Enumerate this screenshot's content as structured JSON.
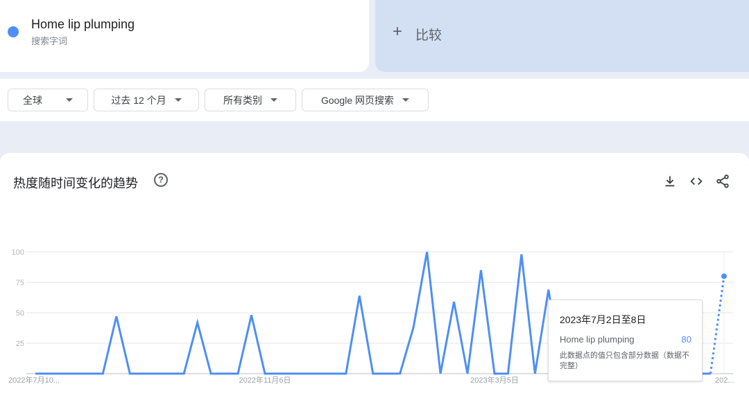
{
  "term": {
    "name": "Home lip plumping",
    "subtitle": "搜索字词",
    "color": "#4e8ef7"
  },
  "compare": {
    "plus": "+",
    "label": "比较"
  },
  "filters": [
    {
      "label": "全球"
    },
    {
      "label": "过去 12 个月"
    },
    {
      "label": "所有类别"
    },
    {
      "label": "Google 网页搜索"
    }
  ],
  "chart_section": {
    "title": "热度随时间变化的趋势",
    "help": "?",
    "icons": [
      "download-icon",
      "embed-code-icon",
      "share-icon"
    ]
  },
  "tooltip": {
    "date": "2023年7月2日至8日",
    "term": "Home lip plumping",
    "value": "80",
    "note": "此数据点的值只包含部分数据（数据不完整）"
  },
  "chart_data": {
    "type": "line",
    "title": "热度随时间变化的趋势",
    "xlabel": "",
    "ylabel": "",
    "ylim": [
      0,
      100
    ],
    "yticks": [
      "25",
      "50",
      "75",
      "100"
    ],
    "xtick_labels": [
      {
        "index": 0,
        "label": "2022年7月10..."
      },
      {
        "index": 17,
        "label": "2022年11月6日"
      },
      {
        "index": 34,
        "label": "2023年3月5日"
      },
      {
        "index": 51,
        "label": "202..."
      }
    ],
    "grid": true,
    "series": [
      {
        "name": "Home lip plumping",
        "color": "#4e8ef7",
        "partial_last_point": true,
        "values": [
          0,
          0,
          0,
          0,
          0,
          0,
          47,
          0,
          0,
          0,
          0,
          0,
          42,
          0,
          0,
          0,
          48,
          0,
          0,
          0,
          0,
          0,
          0,
          0,
          64,
          0,
          0,
          0,
          38,
          100,
          0,
          59,
          0,
          85,
          0,
          0,
          98,
          0,
          69,
          0,
          0,
          0,
          0,
          0,
          0,
          0,
          0,
          0,
          0,
          0,
          0,
          80
        ]
      }
    ]
  }
}
